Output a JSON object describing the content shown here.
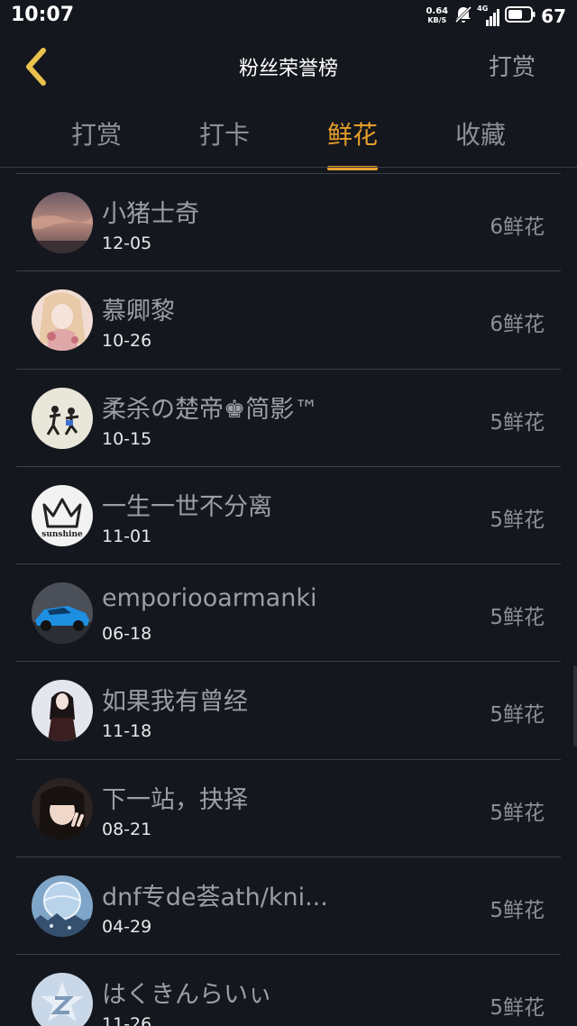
{
  "status_bar": {
    "time": "10:07",
    "net_speed_value": "0.64",
    "net_speed_unit": "KB/S",
    "network_type": "4G",
    "battery_level": "67"
  },
  "header": {
    "title": "粉丝荣誉榜",
    "action_label": "打赏",
    "back_icon": "chevron-left-icon",
    "accent_color": "#e79f2a"
  },
  "tabs": [
    {
      "label": "打赏",
      "active": false
    },
    {
      "label": "打卡",
      "active": false
    },
    {
      "label": "鲜花",
      "active": true
    },
    {
      "label": "收藏",
      "active": false
    }
  ],
  "fans": [
    {
      "name": "小猪士奇",
      "date": "12-05",
      "count": "6鲜花",
      "avatar": "sunset-sky-avatar"
    },
    {
      "name": "慕卿黎",
      "date": "10-26",
      "count": "6鲜花",
      "avatar": "anime-girl-avatar"
    },
    {
      "name": "柔杀の楚帝♚简影™",
      "date": "10-15",
      "count": "5鲜花",
      "avatar": "dancing-figures-avatar"
    },
    {
      "name": "一生一世不分离",
      "date": "11-01",
      "count": "5鲜花",
      "avatar": "crown-sunshine-avatar",
      "avatar_text": "sunshine"
    },
    {
      "name": "emporiooarmanki",
      "date": "06-18",
      "count": "5鲜花",
      "avatar": "blue-sports-car-avatar"
    },
    {
      "name": "如果我有曾经",
      "date": "11-18",
      "count": "5鲜花",
      "avatar": "dark-hair-girl-avatar"
    },
    {
      "name": "下一站，抉择",
      "date": "08-21",
      "count": "5鲜花",
      "avatar": "peace-sign-girl-avatar"
    },
    {
      "name": "dnf专de荟ath/kni...",
      "date": "04-29",
      "count": "5鲜花",
      "avatar": "snow-globe-avatar"
    },
    {
      "name": "はくきんらいぃ",
      "date": "11-26",
      "count": "5鲜花",
      "avatar": "default-z-avatar"
    }
  ]
}
